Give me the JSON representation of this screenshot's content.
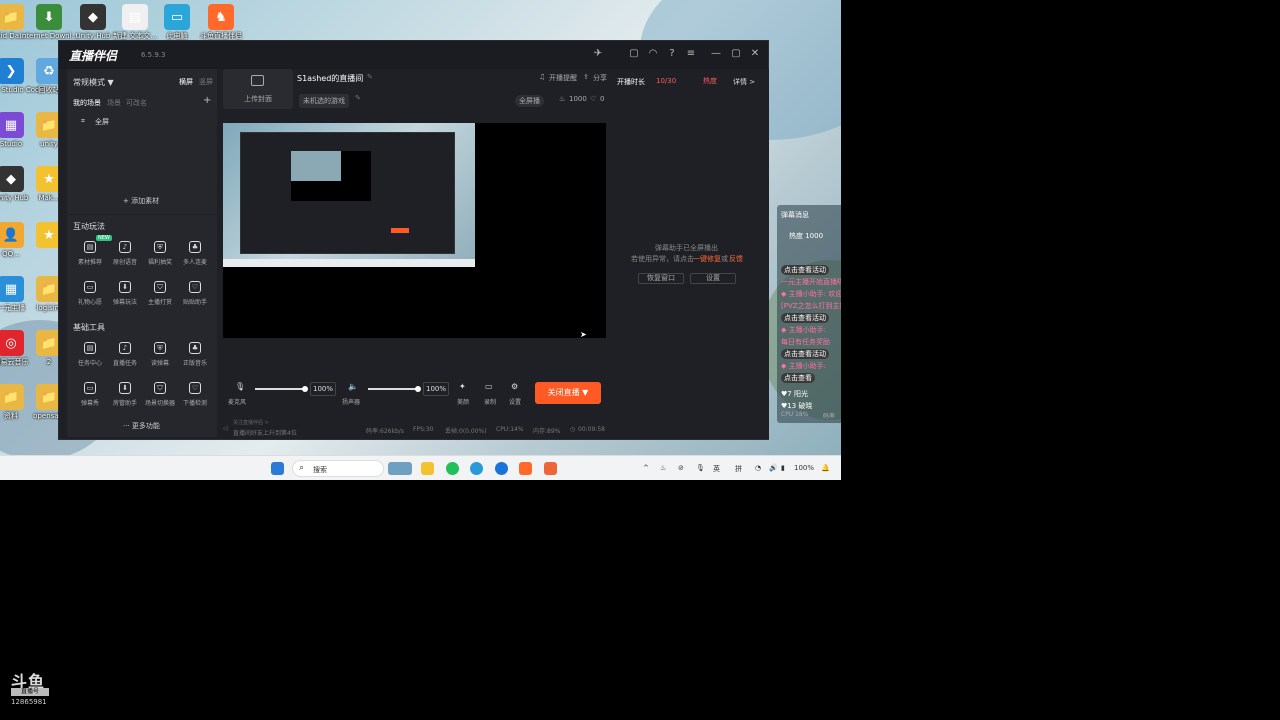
{
  "desktop": {
    "icons": [
      {
        "label": "Eid Da...",
        "glyph": "📁",
        "color": "#e9b844"
      },
      {
        "label": "Internet Downl...",
        "glyph": "⬇",
        "color": "#3b8d3b"
      },
      {
        "label": "Unity Hub",
        "glyph": "◆",
        "color": "#333"
      },
      {
        "label": "新建 文本文...",
        "glyph": "▤",
        "color": "#f0f0f0"
      },
      {
        "label": "此电脑",
        "glyph": "▭",
        "color": "#2aa7d8"
      },
      {
        "label": "斗鱼直播伴侣",
        "glyph": "♞",
        "color": "#ff6a2a"
      },
      {
        "label": "Visual Studio Code",
        "glyph": "❯",
        "color": "#1f7fd3"
      },
      {
        "label": "回收站",
        "glyph": "♻",
        "color": "#5fa8e0"
      },
      {
        "label": "Studio",
        "glyph": "▦",
        "color": "#7b4bd6"
      },
      {
        "label": "unity",
        "glyph": "📁",
        "color": "#e9b844"
      },
      {
        "label": "Unity Hub",
        "glyph": "◆",
        "color": "#333"
      },
      {
        "label": "Mak...",
        "glyph": "★",
        "color": "#f2c230"
      },
      {
        "label": "QQ...",
        "glyph": "👤",
        "color": "#f2a830"
      },
      {
        "label": "",
        "glyph": "★",
        "color": "#f2c230"
      },
      {
        "label": "一元主播",
        "glyph": "▦",
        "color": "#2a8fd6"
      },
      {
        "label": "logisim",
        "glyph": "📁",
        "color": "#e9b844"
      },
      {
        "label": "网易云音乐",
        "glyph": "◎",
        "color": "#e0262c"
      },
      {
        "label": "2",
        "glyph": "📁",
        "color": "#e9b844"
      },
      {
        "label": "资料",
        "glyph": "📁",
        "color": "#e9b844"
      },
      {
        "label": "opensale",
        "glyph": "📁",
        "color": "#e9b844"
      }
    ]
  },
  "app": {
    "logo": "直播伴侣",
    "version": "6.5.9.3",
    "title_icons": [
      "plane-icon",
      "chat-icon",
      "headset-icon",
      "help-icon",
      "menu-icon",
      "minimize-icon",
      "maximize-icon",
      "close-icon"
    ],
    "sidebar": {
      "mode_label": "常规模式 ▼",
      "orientation": [
        "横屏",
        "竖屏"
      ],
      "scene_tabs": [
        "我的场景",
        "场景",
        "可改名"
      ],
      "add": "+",
      "scene_item": "全屏",
      "add_material": "+ 添加素材",
      "interactive_title": "互动玩法",
      "new_badge": "NEW",
      "interactive_tools": [
        "素材推荐",
        "原创语音",
        "福利抽奖",
        "多人连麦",
        "礼物心愿",
        "弹幕玩法",
        "主播打赏",
        "贴贴助手"
      ],
      "basic_title": "基础工具",
      "basic_tools": [
        "任务中心",
        "直播任务",
        "读弹幕",
        "正版音乐",
        "弹幕秀",
        "房管助手",
        "场景切换器",
        "下播检测"
      ],
      "more": "··· 更多功能"
    },
    "center": {
      "upload_cover": "上传封面",
      "room_title": "S1ashed的直播间",
      "category": "未机选的游戏",
      "notify": "开播提醒",
      "share": "分享",
      "fullscreen": "全屏播",
      "popularity": "1000",
      "likes": "0",
      "mic_label": "麦克风",
      "mic_volume": "100%",
      "speaker_label": "扬声器",
      "speaker_volume": "100%",
      "beauty_label": "美颜",
      "record_label": "录制",
      "settings_label": "设置",
      "live_button": "关闭直播 ▼",
      "status_notice": "关注直播伴侣 >",
      "status_notice2": "直播间好友上升到第4位",
      "bitrate": "码率:626kb/s",
      "fps": "FPS:30",
      "dropped": "丢帧:0(0.00%)",
      "cpu": "CPU:14%",
      "memory": "内存:89%",
      "duration": "00:09:58"
    },
    "right": {
      "live_time_label": "开播时长",
      "progress": "10/30",
      "hot_label": "热度",
      "detail": "详情 >",
      "msg_line1": "弹幕助手已全屏播出",
      "msg_line2_pre": "若使用异常，请点击",
      "msg_link1": "一键修复",
      "msg_or": "或",
      "msg_link2": "反馈",
      "btn_reset": "恢复窗口",
      "btn_settings": "设置"
    }
  },
  "danmaku": {
    "title": "弹幕消息",
    "hot": "热度 1000",
    "lines": [
      {
        "text": "点击查看活动",
        "color": "#ffffff",
        "bg": "#3a3a3a"
      },
      {
        "text": "一元主播开始直播啦",
        "color": "#ff6fa0",
        "bg": ""
      },
      {
        "text": "◆ 主播小助手: 欢迎",
        "color": "#ff6fa0",
        "bg": ""
      },
      {
        "text": "[PVZ之怎么打到主播",
        "color": "#ff6fa0",
        "bg": ""
      },
      {
        "text": "点击查看活动",
        "color": "#ffffff",
        "bg": "#3a3a3a"
      },
      {
        "text": "◆ 主播小助手: ",
        "color": "#ff6fa0",
        "bg": ""
      },
      {
        "text": "每日有任务奖励",
        "color": "#ff6fa0",
        "bg": ""
      },
      {
        "text": "点击查看活动",
        "color": "#ffffff",
        "bg": "#3a3a3a"
      },
      {
        "text": "◆ 主播小助手:",
        "color": "#ff6fa0",
        "bg": ""
      },
      {
        "text": "点击查看",
        "color": "#ffffff",
        "bg": "#3a3a3a"
      },
      {
        "text": "♥7 阳光",
        "color": "#ffffff",
        "bg": ""
      },
      {
        "text": "♥13 破晓",
        "color": "#ffffff",
        "bg": ""
      }
    ],
    "cpu": "CPU 18%",
    "bitrate": "码率"
  },
  "taskbar": {
    "search_placeholder": "搜索",
    "tray_lang": "英",
    "tray_ime": "拼",
    "battery": "100%"
  },
  "watermark": {
    "logo": "斗鱼",
    "sub": "直播号",
    "id": "12865981"
  }
}
